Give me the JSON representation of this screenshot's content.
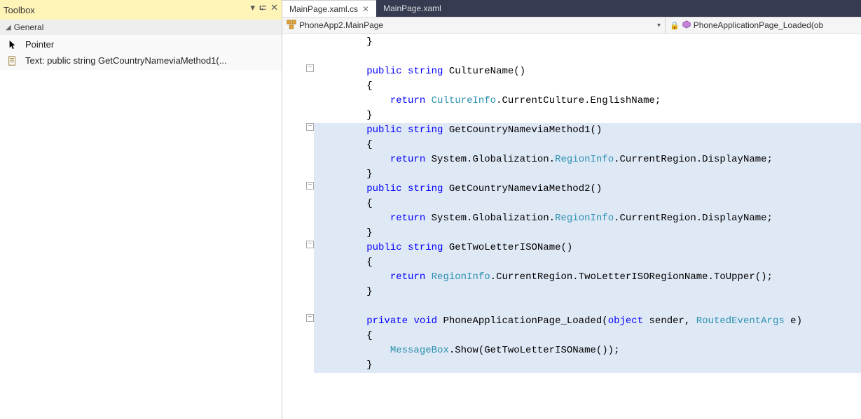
{
  "toolbox": {
    "title": "Toolbox",
    "section": "General",
    "pointer_label": "Pointer",
    "text_item_label": "Text:   public string GetCountryNameviaMethod1(..."
  },
  "tabs": {
    "active": "MainPage.xaml.cs",
    "other": "MainPage.xaml"
  },
  "nav": {
    "class_dropdown": "PhoneApp2.MainPage",
    "member_dropdown": "PhoneApplicationPage_Loaded(ob"
  },
  "code": {
    "l1": "        }",
    "l2": "",
    "l3_pre": "        ",
    "l3_kw1": "public",
    "l3_mid1": " ",
    "l3_kw2": "string",
    "l3_rest": " CultureName()",
    "l4": "        {",
    "l5_pre": "            ",
    "l5_kw": "return",
    "l5_mid": " ",
    "l5_type": "CultureInfo",
    "l5_rest": ".CurrentCulture.EnglishName;",
    "l6": "        }",
    "l7_pre": "        ",
    "l7_kw1": "public",
    "l7_mid1": " ",
    "l7_kw2": "string",
    "l7_rest": " GetCountryNameviaMethod1()",
    "l8": "        {",
    "l9_pre": "            ",
    "l9_kw": "return",
    "l9_mid": " System.Globalization.",
    "l9_type": "RegionInfo",
    "l9_rest": ".CurrentRegion.DisplayName;",
    "l10": "        }",
    "l11_pre": "        ",
    "l11_kw1": "public",
    "l11_mid1": " ",
    "l11_kw2": "string",
    "l11_rest": " GetCountryNameviaMethod2()",
    "l12": "        {",
    "l13_pre": "            ",
    "l13_kw": "return",
    "l13_mid": " System.Globalization.",
    "l13_type": "RegionInfo",
    "l13_rest": ".CurrentRegion.DisplayName;",
    "l14": "        }",
    "l15_pre": "        ",
    "l15_kw1": "public",
    "l15_mid1": " ",
    "l15_kw2": "string",
    "l15_rest": " GetTwoLetterISOName()",
    "l16": "        {",
    "l17_pre": "            ",
    "l17_kw": "return",
    "l17_mid": " ",
    "l17_type": "RegionInfo",
    "l17_rest": ".CurrentRegion.TwoLetterISORegionName.ToUpper();",
    "l18": "        }",
    "l19": "",
    "l20_pre": "        ",
    "l20_kw1": "private",
    "l20_mid1": " ",
    "l20_kw2": "void",
    "l20_mid2": " PhoneApplicationPage_Loaded(",
    "l20_kw3": "object",
    "l20_mid3": " sender, ",
    "l20_type": "RoutedEventArgs",
    "l20_rest": " e)",
    "l21": "        {",
    "l22_pre": "            ",
    "l22_type": "MessageBox",
    "l22_rest": ".Show(GetTwoLetterISOName());",
    "l23": "        }"
  }
}
